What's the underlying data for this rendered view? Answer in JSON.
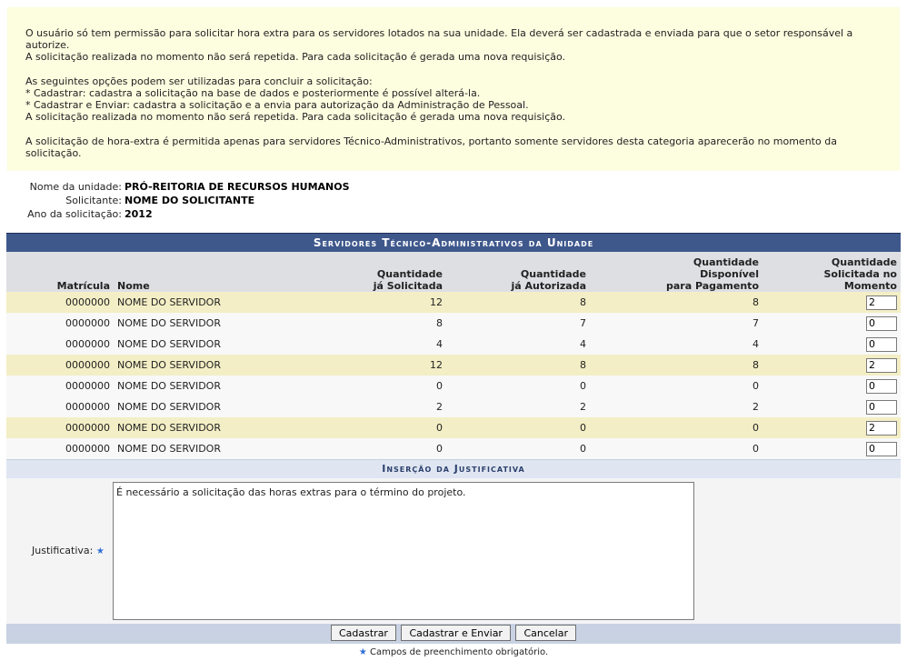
{
  "help": {
    "lines": [
      "O usuário só tem permissão para solicitar hora extra para os servidores lotados na sua unidade. Ela deverá ser cadastrada e enviada para que o setor responsável a autorize.",
      "A solicitação realizada no momento não será repetida. Para cada solicitação é gerada uma nova requisição.",
      "As seguintes opções podem ser utilizadas para concluir a solicitação:",
      "* Cadastrar: cadastra a solicitação na base de dados e posteriormente é possível alterá-la.",
      "* Cadastrar e Enviar: cadastra a solicitação e a envia para autorização da Administração de Pessoal.",
      "A solicitação realizada no momento não será repetida. Para cada solicitação é gerada uma nova requisição.",
      "A solicitação de hora-extra é permitida apenas para servidores Técnico-Administrativos, portanto somente servidores desta categoria aparecerão no momento da solicitação."
    ]
  },
  "info": {
    "unit_label": "Nome da unidade:",
    "unit_value": "PRÓ-REITORIA DE RECURSOS HUMANOS",
    "requester_label": "Solicitante:",
    "requester_value": "NOME DO SOLICITANTE",
    "year_label": "Ano da solicitação:",
    "year_value": "2012"
  },
  "table": {
    "caption": "Servidores Técnico-Administrativos da Unidade",
    "headers": {
      "matricula": "Matrícula",
      "nome": "Nome",
      "solicitada_1": "Quantidade",
      "solicitada_2": "já Solicitada",
      "autorizada_1": "Quantidade",
      "autorizada_2": "já Autorizada",
      "disponivel_1": "Quantidade",
      "disponivel_2": "Disponível",
      "disponivel_3": "para Pagamento",
      "momento_1": "Quantidade",
      "momento_2": "Solicitada no",
      "momento_3": "Momento"
    },
    "rows": [
      {
        "matricula": "0000000",
        "nome": "NOME DO SERVIDOR",
        "solicitada": "12",
        "autorizada": "8",
        "disponivel": "8",
        "momento": "2"
      },
      {
        "matricula": "0000000",
        "nome": "NOME DO SERVIDOR",
        "solicitada": "8",
        "autorizada": "7",
        "disponivel": "7",
        "momento": "0"
      },
      {
        "matricula": "0000000",
        "nome": "NOME DO SERVIDOR",
        "solicitada": "4",
        "autorizada": "4",
        "disponivel": "4",
        "momento": "0"
      },
      {
        "matricula": "0000000",
        "nome": "NOME DO SERVIDOR",
        "solicitada": "12",
        "autorizada": "8",
        "disponivel": "8",
        "momento": "2"
      },
      {
        "matricula": "0000000",
        "nome": "NOME DO SERVIDOR",
        "solicitada": "0",
        "autorizada": "0",
        "disponivel": "0",
        "momento": "0"
      },
      {
        "matricula": "0000000",
        "nome": "NOME DO SERVIDOR",
        "solicitada": "2",
        "autorizada": "2",
        "disponivel": "2",
        "momento": "0"
      },
      {
        "matricula": "0000000",
        "nome": "NOME DO SERVIDOR",
        "solicitada": "0",
        "autorizada": "0",
        "disponivel": "0",
        "momento": "2"
      },
      {
        "matricula": "0000000",
        "nome": "NOME DO SERVIDOR",
        "solicitada": "0",
        "autorizada": "0",
        "disponivel": "0",
        "momento": "0"
      }
    ]
  },
  "justification": {
    "section_title": "Inserção da Justificativa",
    "label": "Justificativa:",
    "required_mark": "★",
    "value": "É necessário a solicitação das horas extras para o término do projeto."
  },
  "buttons": {
    "cadastrar": "Cadastrar",
    "cadastrar_enviar": "Cadastrar e Enviar",
    "cancelar": "Cancelar"
  },
  "footnote": {
    "star": "★",
    "text": "Campos de preenchimento obrigatório."
  },
  "colors": {
    "caption_bg": "#3f588c",
    "highlight_row": "#f3eec5",
    "help_bg": "#fdfde0"
  }
}
